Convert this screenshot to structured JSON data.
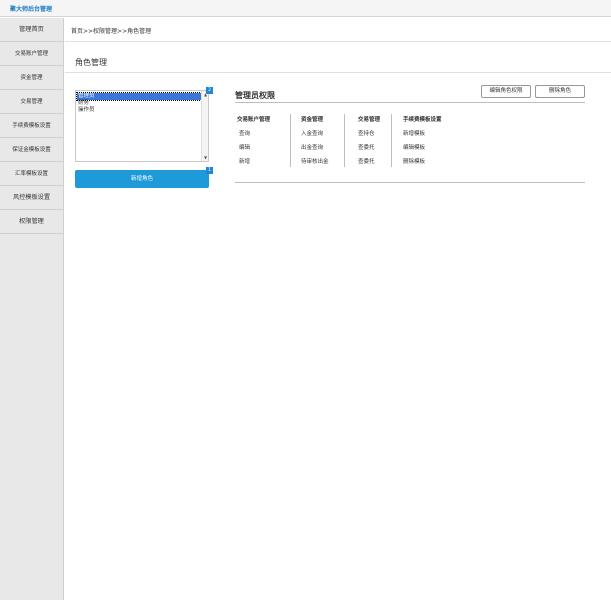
{
  "app": {
    "title": "聚大师后台管理"
  },
  "sidebar": {
    "items": [
      {
        "label": "管理首页"
      },
      {
        "label": "交易账户管理"
      },
      {
        "label": "资金管理"
      },
      {
        "label": "交易管理"
      },
      {
        "label": "手续费模板设置"
      },
      {
        "label": "保证金模板设置"
      },
      {
        "label": "汇率模板设置"
      },
      {
        "label": "风控模板设置"
      },
      {
        "label": "权限管理"
      }
    ]
  },
  "breadcrumb": "首页>>权限管理>>角色管理",
  "page_title": "角色管理",
  "roles": {
    "items": [
      "管理员",
      "财务",
      "操作员"
    ],
    "selected": "管理员",
    "badge_top": "2",
    "badge_button": "1",
    "add_button": "新增角色"
  },
  "permissions": {
    "title": "管理员权限",
    "edit_button": "编辑角色权限",
    "delete_button": "删除角色",
    "columns": [
      {
        "title": "交易账户管理",
        "items": [
          "查询",
          "编辑",
          "新增"
        ]
      },
      {
        "title": "资金管理",
        "items": [
          "入金查询",
          "出金查询",
          "待审核出金"
        ]
      },
      {
        "title": "交易管理",
        "items": [
          "查持仓",
          "查委托",
          "查委托"
        ]
      },
      {
        "title": "手续费模板设置",
        "items": [
          "新增模板",
          "编辑模板",
          "删除模板"
        ]
      }
    ]
  },
  "colors": {
    "brand": "#1a7bc4",
    "primary_button": "#1f9ad8",
    "selection": "#3a77d8"
  }
}
